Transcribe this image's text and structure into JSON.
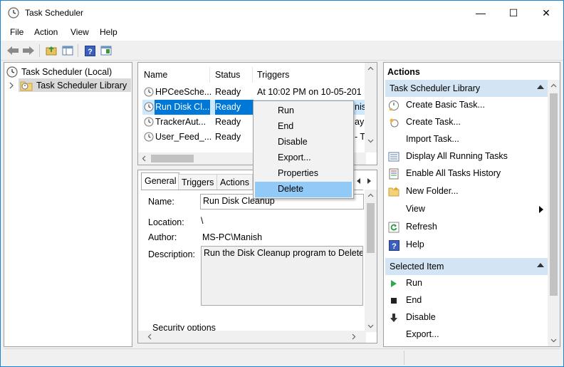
{
  "window": {
    "title": "Task Scheduler",
    "controls": {
      "minimize": "—",
      "maximize": "☐",
      "close": "✕"
    }
  },
  "menu": [
    "File",
    "Action",
    "View",
    "Help"
  ],
  "toolbar": [
    "back-icon",
    "forward-icon",
    "up-folder-icon",
    "properties-pane-icon",
    "help-icon",
    "show-pane-icon"
  ],
  "tree": {
    "root": "Task Scheduler (Local)",
    "child": "Task Scheduler Library"
  },
  "task_list": {
    "columns": [
      "Name",
      "Status",
      "Triggers"
    ],
    "rows": [
      {
        "name": "HPCeeSche...",
        "status": "Ready",
        "trigger": "At 10:02 PM on 10-05-201"
      },
      {
        "name": "Run Disk Cl...",
        "status": "Ready",
        "trigger": "nis"
      },
      {
        "name": "TrackerAut...",
        "status": "Ready",
        "trigger": "ay"
      },
      {
        "name": "User_Feed_...",
        "status": "Ready",
        "trigger": "- T"
      }
    ]
  },
  "context_menu": [
    "Run",
    "End",
    "Disable",
    "Export...",
    "Properties",
    "Delete"
  ],
  "details": {
    "tabs": [
      "General",
      "Triggers",
      "Actions"
    ],
    "name_label": "Name:",
    "name_value": "Run Disk Cleanup",
    "location_label": "Location:",
    "location_value": "\\",
    "author_label": "Author:",
    "author_value": "MS-PC\\Manish",
    "description_label": "Description:",
    "description_value": "Run the Disk Cleanup program to Delete t",
    "security_label": "Security options"
  },
  "actions": {
    "header": "Actions",
    "section1": "Task Scheduler Library",
    "items1": [
      {
        "label": "Create Basic Task...",
        "icon": "create-basic-task-icon"
      },
      {
        "label": "Create Task...",
        "icon": "create-task-icon"
      },
      {
        "label": "Import Task...",
        "icon": ""
      },
      {
        "label": "Display All Running Tasks",
        "icon": "running-tasks-icon"
      },
      {
        "label": "Enable All Tasks History",
        "icon": "history-icon"
      },
      {
        "label": "New Folder...",
        "icon": "folder-icon"
      },
      {
        "label": "View",
        "icon": ""
      },
      {
        "label": "Refresh",
        "icon": "refresh-icon"
      },
      {
        "label": "Help",
        "icon": "help-icon"
      }
    ],
    "section2": "Selected Item",
    "items2": [
      {
        "label": "Run",
        "icon": "run-icon"
      },
      {
        "label": "End",
        "icon": "end-icon"
      },
      {
        "label": "Disable",
        "icon": "disable-icon"
      },
      {
        "label": "Export...",
        "icon": ""
      }
    ]
  }
}
